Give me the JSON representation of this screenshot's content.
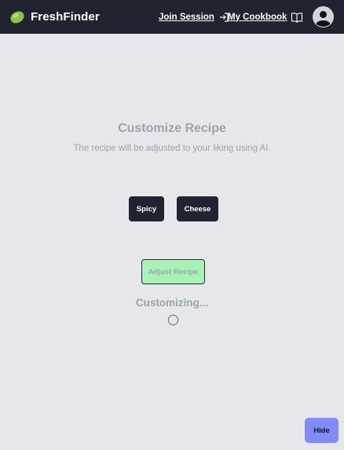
{
  "navbar": {
    "brand_name": "FreshFinder",
    "brand_icon": "lime-logo-icon",
    "join_session_label": "Join Session",
    "join_session_icon": "sign-in-icon",
    "cookbook_label": "My Cookbook",
    "cookbook_icon": "open-book-icon",
    "avatar_icon": "user-avatar-icon"
  },
  "main": {
    "title": "Customize Recipe",
    "subtitle": "The recipe will be adjusted to your liking using AI.",
    "preferences": [
      "Spicy",
      "Cheese"
    ],
    "adjust_button_label": "Adjust Recipe",
    "status_text": "Customizing...",
    "status_icon": "loading-spinner-icon"
  },
  "hide_button_label": "Hide",
  "colors": {
    "navbar_bg": "#1f2430",
    "page_bg": "#e5e7eb",
    "accent_green": "#8bc34a",
    "adjust_button_bg": "#a7f3b5",
    "hide_button_bg": "#818cf8",
    "muted_text": "#9ca3af"
  }
}
